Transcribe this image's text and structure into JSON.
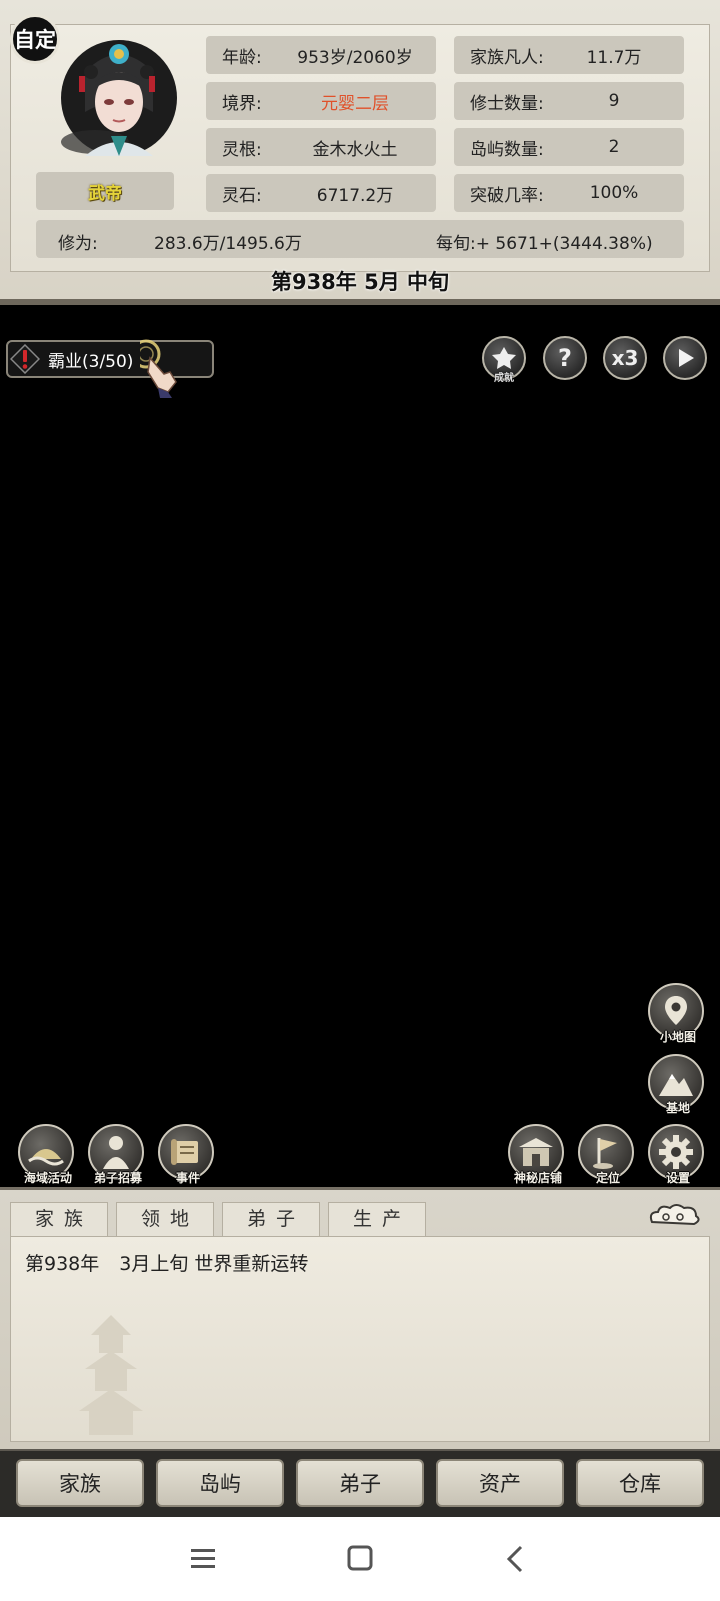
{
  "header": {
    "custom_badge": "自定",
    "character_name": "武帝",
    "stats_left": [
      {
        "label": "年龄:",
        "value": "953岁/2060岁"
      },
      {
        "label": "境界:",
        "value": "元婴二层"
      },
      {
        "label": "灵根:",
        "value": "金木水火土"
      },
      {
        "label": "灵石:",
        "value": "6717.2万"
      }
    ],
    "stats_right": [
      {
        "label": "家族凡人:",
        "value": "11.7万"
      },
      {
        "label": "修士数量:",
        "value": "9"
      },
      {
        "label": "岛屿数量:",
        "value": "2"
      },
      {
        "label": "突破几率:",
        "value": "100%"
      }
    ],
    "cultivation": {
      "label": "修为:",
      "value": "283.6万/1495.6万",
      "rate": "每旬:+ 5671+(3444.38%)"
    },
    "date": "第938年 5月 中旬"
  },
  "quest": {
    "label": "霸业(3/50)"
  },
  "top_buttons": {
    "achievement_caption": "成就",
    "help": "?",
    "speed": "x3"
  },
  "map_buttons": {
    "minimap": "小地图",
    "base": "基地",
    "sea_activity": "海域活动",
    "recruit": "弟子招募",
    "events": "事件",
    "shop": "神秘店铺",
    "locate": "定位",
    "settings": "设置"
  },
  "log": {
    "tabs": [
      "家族",
      "领地",
      "弟子",
      "生产"
    ],
    "entries": [
      {
        "year": "第938年",
        "text": "3月上旬 世界重新运转"
      }
    ]
  },
  "nav": [
    "家族",
    "岛屿",
    "弟子",
    "资产",
    "仓库"
  ],
  "colors": {
    "realm_red": "#e0512a",
    "name_gold": "#e4d33a"
  }
}
